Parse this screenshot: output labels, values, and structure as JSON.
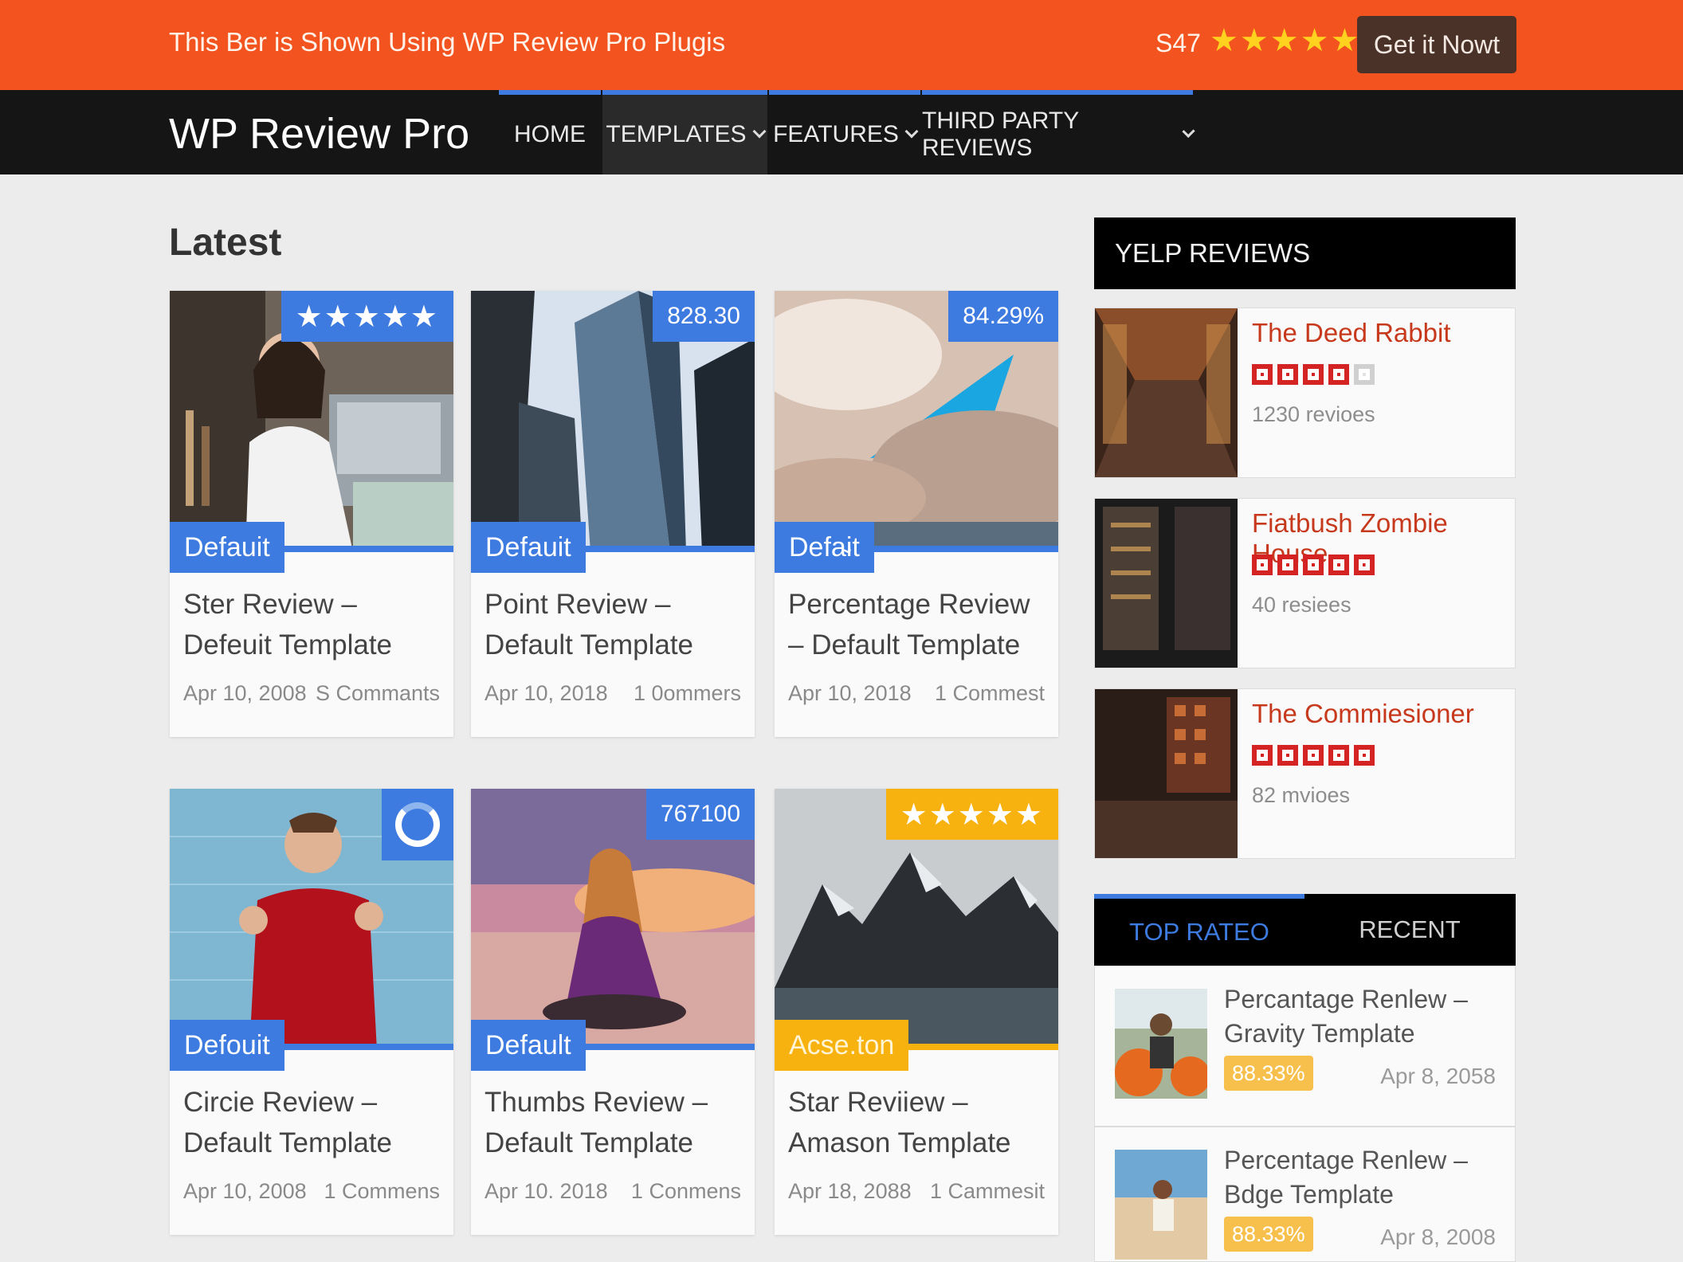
{
  "promo": {
    "message": "This Ber is Shown Using WP Review Pro Plugis",
    "price": "S47",
    "stars": "★★★★★",
    "cta_label": "Get it Nowt",
    "accent": "#f3531f"
  },
  "nav": {
    "logo": "WP Review Pro",
    "items": [
      {
        "label": "HOME"
      },
      {
        "label": "TEMPLATES"
      },
      {
        "label": "FEATURES"
      },
      {
        "label": "THIRD PARTY REVIEWS"
      }
    ]
  },
  "main": {
    "heading": "Latest",
    "cards": [
      {
        "category": "Defauit",
        "badge": "★★★★★",
        "title": "Ster Review – Defeuit Template",
        "date": "Apr 10, 2008",
        "comments": "S Commants",
        "icon": "star-rating"
      },
      {
        "category": "Defauit",
        "badge": "828.30",
        "title": "Point Review – Default Template",
        "date": "Apr 10, 2018",
        "comments": "1 0ommers",
        "icon": "point-rating"
      },
      {
        "category": "Defa̴it",
        "badge": "84.29%",
        "title": "Percentage Review – Default Template",
        "date": "Apr 10, 2018",
        "comments": "1 Commest",
        "icon": "percentage-rating"
      },
      {
        "category": "Defouit",
        "badge": "",
        "title": "Circie Review – Default Template",
        "date": "Apr 10, 2008",
        "comments": "1 Commens",
        "icon": "circle-rating"
      },
      {
        "category": "Default",
        "badge": "767100",
        "title": "Thumbs Review – Default Template",
        "date": "Apr 10. 2018",
        "comments": "1 Conmens",
        "icon": "thumbs-rating"
      },
      {
        "category": "Acse.ton",
        "badge": "★★★★★",
        "title": "Star Reviiew – Amason Template",
        "date": "Apr 18, 2088",
        "comments": "1 Cammesit",
        "icon": "star-rating"
      }
    ]
  },
  "yelp": {
    "heading": "YELP REVIEWS",
    "items": [
      {
        "name": "The Deed Rabbit",
        "rating": 4,
        "count": "1230 revioes"
      },
      {
        "name": "Fiatbush Zombie House",
        "rating": 4.5,
        "count": "40 resiees"
      },
      {
        "name": "The Commiesioner",
        "rating": 5,
        "count": "82 mvioes"
      }
    ],
    "brand_color": "#d32323"
  },
  "tabs": {
    "active": "TOP RATEO",
    "inactive": "RECENT",
    "items": [
      {
        "title": "Percantage Renlew – Gravity Template",
        "percent": "88.33%",
        "date": "Apr 8, 2058"
      },
      {
        "title": "Percentage Renlew – Bdge Template",
        "percent": "88.33%",
        "date": "Apr 8, 2008"
      }
    ]
  }
}
